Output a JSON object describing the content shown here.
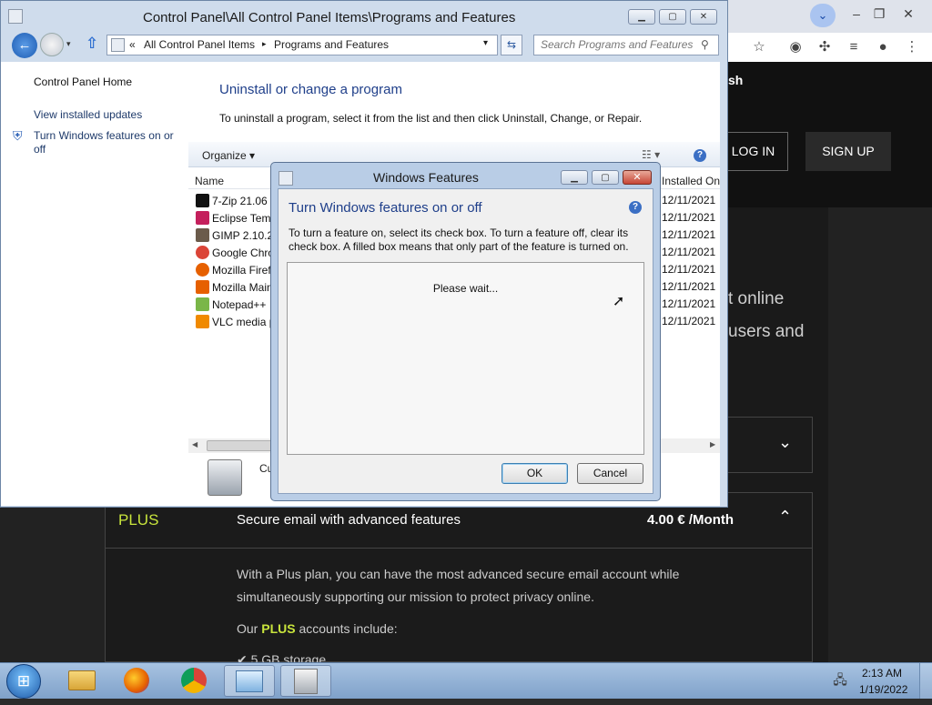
{
  "browser": {
    "tab_menu_icon": "chevron-down-icon",
    "toolbar_icons": [
      "star-icon",
      "extension-icon",
      "puzzle-icon",
      "media-icon",
      "profile-icon",
      "menu-icon"
    ],
    "nav_brand_fragment": "sh",
    "login_label": "LOG IN",
    "signup_label": "SIGN UP",
    "hero_line1": "t online",
    "hero_line2": "users and",
    "plus_plan": {
      "name": "PLUS",
      "description": "Secure email with advanced features",
      "price": "4.00 € /Month",
      "detail_line1": "With a Plus plan, you can have the most advanced secure email account while",
      "detail_line2": "simultaneously supporting our mission to protect privacy online.",
      "includes_prefix": "Our ",
      "includes_highlight": "PLUS",
      "includes_suffix": " accounts include:",
      "storage_item": "✔ 5 GB storage"
    },
    "accent_color": "#c8e43c"
  },
  "control_panel": {
    "title": "Control Panel\\All Control Panel Items\\Programs and Features",
    "address": {
      "prefix": "«",
      "crumb1": "All Control Panel Items",
      "separator": "▸",
      "crumb2": "Programs and Features"
    },
    "search_placeholder": "Search Programs and Features",
    "sidebar": {
      "home": "Control Panel Home",
      "installed_updates": "View installed updates",
      "features_link_line1": "Turn Windows features on or",
      "features_link_line2": "off"
    },
    "heading": "Uninstall or change a program",
    "instructions": "To uninstall a program, select it from the list and then click Uninstall, Change, or Repair.",
    "organize_label": "Organize ▾",
    "columns": {
      "name": "Name",
      "installed_on": "Installed On"
    },
    "programs": [
      {
        "name": "7-Zip 21.06",
        "date": "12/11/2021",
        "icon": "7zip-icon",
        "color": "#111"
      },
      {
        "name": "Eclipse Tem",
        "date": "12/11/2021",
        "icon": "eclipse-icon",
        "color": "#c4205c"
      },
      {
        "name": "GIMP 2.10.2",
        "date": "12/11/2021",
        "icon": "gimp-icon",
        "color": "#6b5b4b"
      },
      {
        "name": "Google Chro",
        "date": "12/11/2021",
        "icon": "chrome-icon",
        "color": "#db4437"
      },
      {
        "name": "Mozilla Firef",
        "date": "12/11/2021",
        "icon": "firefox-icon",
        "color": "#e66000"
      },
      {
        "name": "Mozilla Main",
        "date": "12/11/2021",
        "icon": "mozilla-icon",
        "color": "#e66000"
      },
      {
        "name": "Notepad++",
        "date": "12/11/2021",
        "icon": "notepadpp-icon",
        "color": "#7ab648"
      },
      {
        "name": "VLC media p",
        "date": "12/11/2021",
        "icon": "vlc-icon",
        "color": "#f08a00"
      }
    ],
    "details_fragment": "Cu"
  },
  "windows_features": {
    "title": "Windows Features",
    "heading": "Turn Windows features on or off",
    "description": "To turn a feature on, select its check box. To turn a feature off, clear its check box. A filled box means that only part of the feature is turned on.",
    "loading_text": "Please wait...",
    "ok_label": "OK",
    "cancel_label": "Cancel",
    "help_label": "?"
  },
  "taskbar": {
    "start_icon": "windows-orb-icon",
    "items": [
      "explorer-icon",
      "firefox-icon",
      "chrome-icon",
      "control-panel-icon",
      "programs-features-icon"
    ],
    "time": "2:13 AM",
    "date": "1/19/2022"
  }
}
